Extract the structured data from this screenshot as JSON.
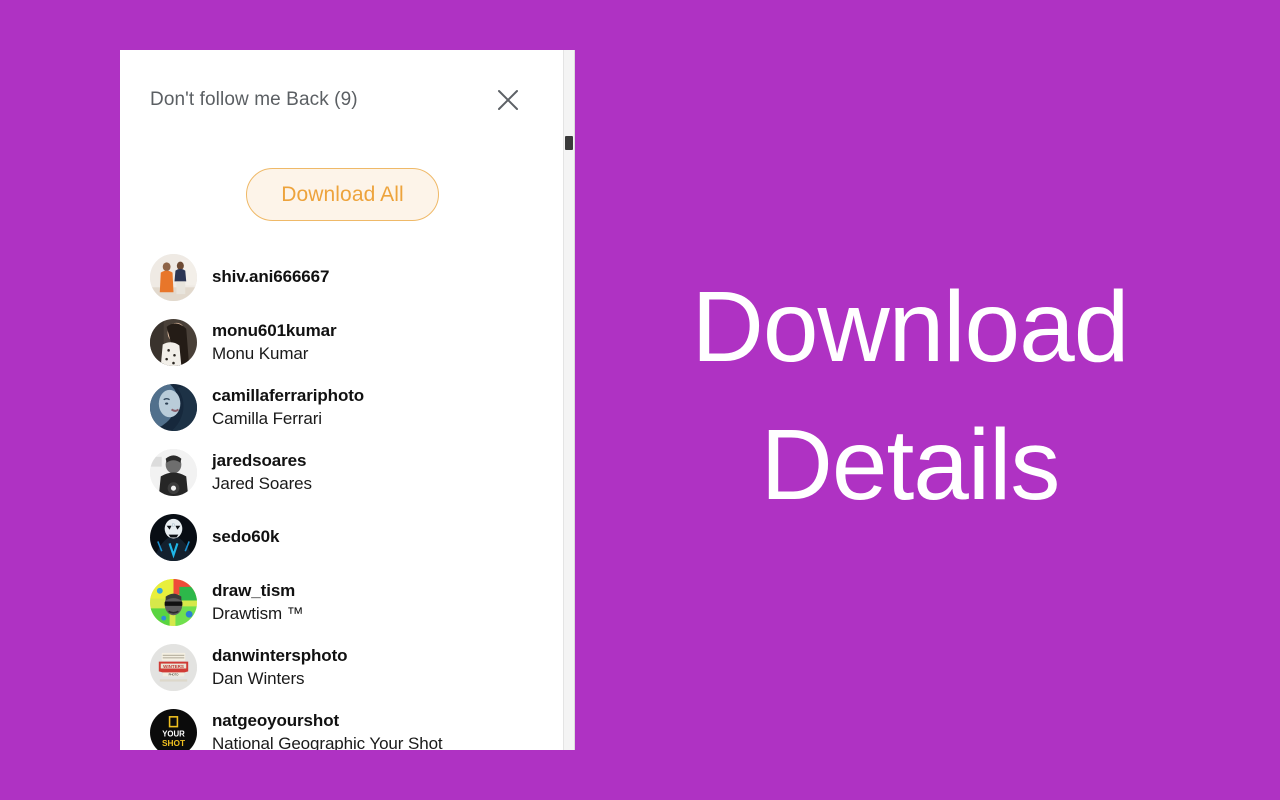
{
  "background_color": "#af32c3",
  "hero": {
    "line1": "Download",
    "line2": "Details",
    "color": "#ffffff"
  },
  "panel": {
    "title": "Don't follow me Back (9)",
    "close_icon": "close-icon",
    "background_color": "#ffffff",
    "download_all": {
      "label": "Download All",
      "text_color": "#eda33c",
      "background_color": "#fdf4e9",
      "border_color": "#efb968"
    },
    "users": [
      {
        "username": "shiv.ani666667",
        "fullname": "",
        "avatar": "two-people-photo-avatar"
      },
      {
        "username": "monu601kumar",
        "fullname": "Monu Kumar",
        "avatar": "long-hair-portrait-avatar"
      },
      {
        "username": "camillaferrariphoto",
        "fullname": "Camilla Ferrari",
        "avatar": "blue-face-art-avatar"
      },
      {
        "username": "jaredsoares",
        "fullname": "Jared Soares",
        "avatar": "black-white-portrait-avatar"
      },
      {
        "username": "sedo60k",
        "fullname": "",
        "avatar": "neon-mask-avatar"
      },
      {
        "username": "draw_tism",
        "fullname": "Drawtism ™",
        "avatar": "rainbow-splatter-face-avatar"
      },
      {
        "username": "danwintersphoto",
        "fullname": "Dan Winters",
        "avatar": "winters-badge-avatar"
      },
      {
        "username": "natgeoyourshot",
        "fullname": "National Geographic Your Shot",
        "avatar": "natgeo-your-shot-avatar"
      }
    ]
  }
}
